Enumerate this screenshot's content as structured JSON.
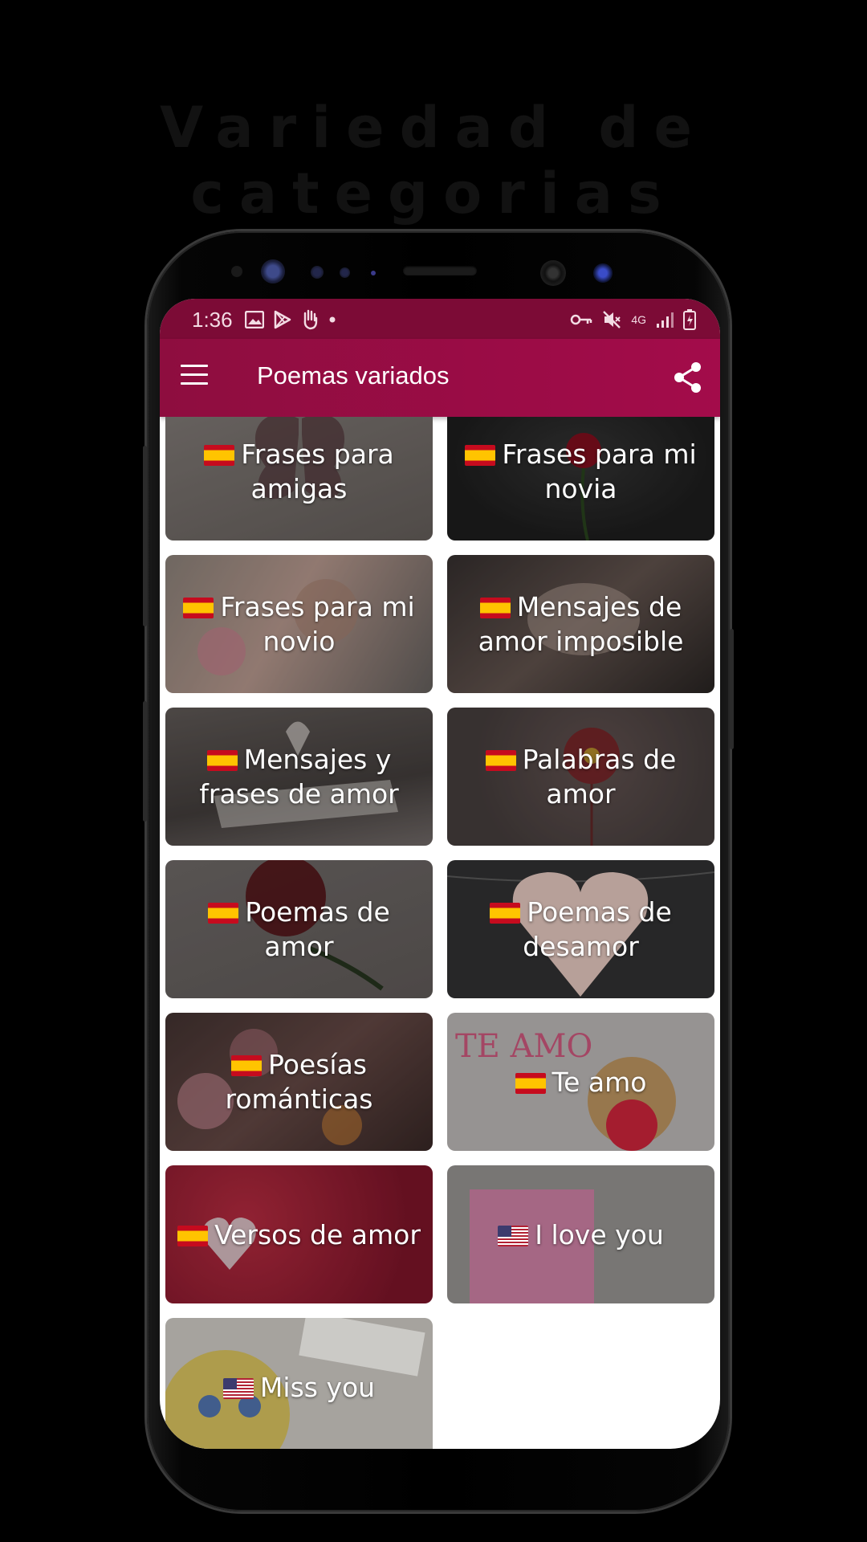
{
  "promo": {
    "title": "Variedad de categorias"
  },
  "status_bar": {
    "time": "1:36",
    "network": "4G"
  },
  "app_bar": {
    "title": "Poemas variados"
  },
  "colors": {
    "status_bar": "#7c0b36",
    "app_bar": "#a30c4a"
  },
  "icons": {
    "menu": "hamburger-menu-icon",
    "share": "share-icon",
    "flag_es": "spain-flag-icon",
    "flag_us": "usa-flag-icon"
  },
  "categories": [
    {
      "label": "Frases para amigas",
      "flag": "es"
    },
    {
      "label": "Frases para mi novia",
      "flag": "es"
    },
    {
      "label": "Frases para mi novio",
      "flag": "es"
    },
    {
      "label": "Mensajes de amor imposible",
      "flag": "es"
    },
    {
      "label": "Mensajes y frases de amor",
      "flag": "es"
    },
    {
      "label": "Palabras de amor",
      "flag": "es"
    },
    {
      "label": "Poemas de amor",
      "flag": "es"
    },
    {
      "label": "Poemas de desamor",
      "flag": "es"
    },
    {
      "label": "Poesías románticas",
      "flag": "es"
    },
    {
      "label": "Te amo",
      "flag": "es"
    },
    {
      "label": "Versos de amor",
      "flag": "es"
    },
    {
      "label": "I love you",
      "flag": "us"
    },
    {
      "label": "Miss you",
      "flag": "us"
    }
  ]
}
